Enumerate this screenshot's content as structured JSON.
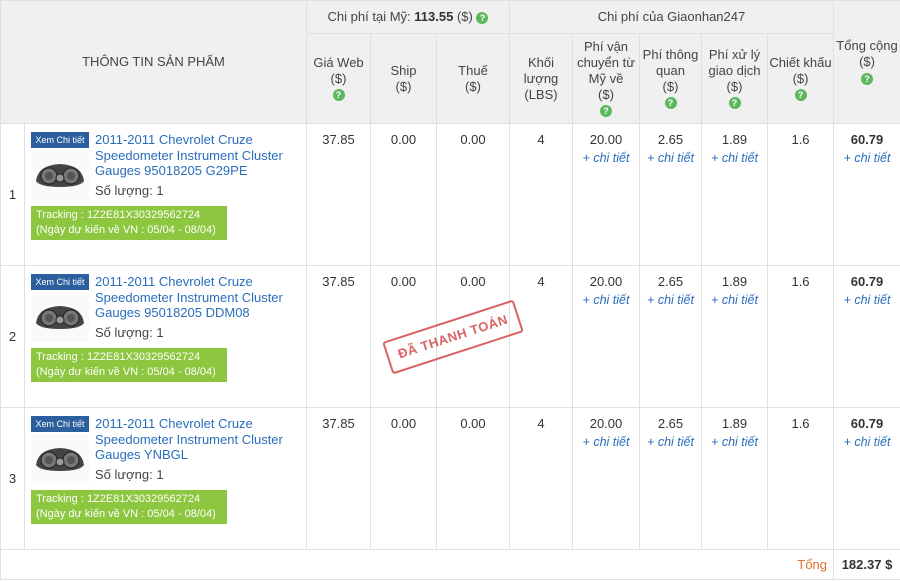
{
  "header": {
    "product_info": "THÔNG TIN SẢN PHẨM",
    "us_cost_label": "Chi phí tại Mỹ:",
    "us_cost_value": "113.55",
    "us_cost_unit": "($)",
    "gn_cost_label": "Chi phí của Giaonhan247",
    "cols": {
      "web_price": "Giá Web",
      "ship": "Ship",
      "tax": "Thuế",
      "weight": "Khối lượng",
      "weight_unit": "(LBS)",
      "shipping_fee": "Phí vận chuyển từ Mỹ về",
      "customs_fee": "Phí thông quan",
      "processing_fee": "Phí xử lý giao dịch",
      "discount": "Chiết khấu",
      "total": "Tổng cộng",
      "unit": "($)"
    }
  },
  "common": {
    "view_detail": "Xem Chi tiết",
    "detail_link": "+ chi tiết",
    "qty_label": "Số lượng:"
  },
  "items": [
    {
      "index": "1",
      "name": "2011-2011 Chevrolet Cruze Speedometer Instrument Cluster Gauges 95018205 G29PE",
      "qty": "1",
      "tracking": "Tracking : 1Z2E81X30329562724",
      "eta": "(Ngày dự kiến về VN : 05/04 - 08/04)",
      "web_price": "37.85",
      "ship": "0.00",
      "tax": "0.00",
      "weight": "4",
      "shipping_fee": "20.00",
      "customs_fee": "2.65",
      "processing_fee": "1.89",
      "discount": "1.6",
      "total": "60.79"
    },
    {
      "index": "2",
      "name": "2011-2011 Chevrolet Cruze Speedometer Instrument Cluster Gauges 95018205 DDM08",
      "qty": "1",
      "tracking": "Tracking : 1Z2E81X30329562724",
      "eta": "(Ngày dự kiến về VN : 05/04 - 08/04)",
      "web_price": "37.85",
      "ship": "0.00",
      "tax": "0.00",
      "weight": "4",
      "shipping_fee": "20.00",
      "customs_fee": "2.65",
      "processing_fee": "1.89",
      "discount": "1.6",
      "total": "60.79"
    },
    {
      "index": "3",
      "name": "2011-2011 Chevrolet Cruze Speedometer Instrument Cluster Gauges YNBGL",
      "qty": "1",
      "tracking": "Tracking : 1Z2E81X30329562724",
      "eta": "(Ngày dự kiến về VN : 05/04 - 08/04)",
      "web_price": "37.85",
      "ship": "0.00",
      "tax": "0.00",
      "weight": "4",
      "shipping_fee": "20.00",
      "customs_fee": "2.65",
      "processing_fee": "1.89",
      "discount": "1.6",
      "total": "60.79"
    }
  ],
  "footer": {
    "total_label": "Tổng",
    "total_value": "182.37 $"
  },
  "stamp": "ĐÃ THANH TOÁN",
  "colors": {
    "link": "#2a6ebb",
    "tracking_bg": "#8dc63f",
    "view_btn_bg": "#2b5f9e",
    "help_icon": "#5cb85c",
    "stamp": "#d23b3b",
    "total_label": "#e0712b"
  }
}
